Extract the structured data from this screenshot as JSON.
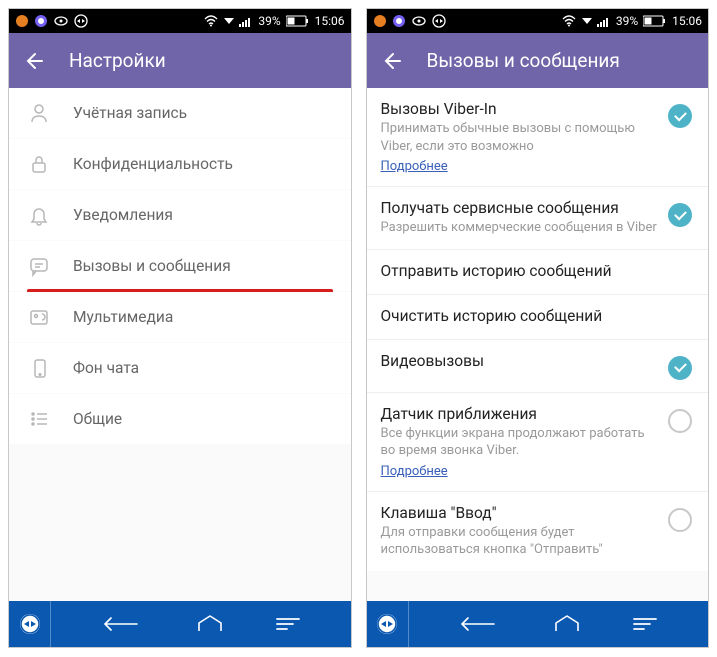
{
  "statusbar": {
    "battery_text": "39%",
    "time": "15:06"
  },
  "left": {
    "title": "Настройки",
    "items": [
      {
        "label": "Учётная запись",
        "icon": "user"
      },
      {
        "label": "Конфиденциальность",
        "icon": "lock"
      },
      {
        "label": "Уведомления",
        "icon": "bell"
      },
      {
        "label": "Вызовы и сообщения",
        "icon": "chat",
        "highlight": true
      },
      {
        "label": "Мультимедиа",
        "icon": "media"
      },
      {
        "label": "Фон чата",
        "icon": "phone-rect"
      },
      {
        "label": "Общие",
        "icon": "list"
      }
    ]
  },
  "right": {
    "title": "Вызовы и сообщения",
    "items": [
      {
        "title": "Вызовы Viber-In",
        "sub": "Принимать обычные вызовы с помощью Viber, если это возможно",
        "more": "Подробнее",
        "check": "on"
      },
      {
        "title": "Получать сервисные сообщения",
        "sub": "Разрешить коммерческие сообщения в Viber",
        "check": "on"
      },
      {
        "title": "Отправить историю сообщений"
      },
      {
        "title": "Очистить историю сообщений"
      },
      {
        "title": "Видеовызовы",
        "check": "on"
      },
      {
        "title": "Датчик приближения",
        "sub": "Все функции экрана продолжают работать во время звонка Viber.",
        "more": "Подробнее",
        "check": "off"
      },
      {
        "title": "Клавиша \"Ввод\"",
        "sub": "Для отправки сообщения будет использоваться кнопка \"Отправить\"",
        "check": "off"
      }
    ]
  }
}
